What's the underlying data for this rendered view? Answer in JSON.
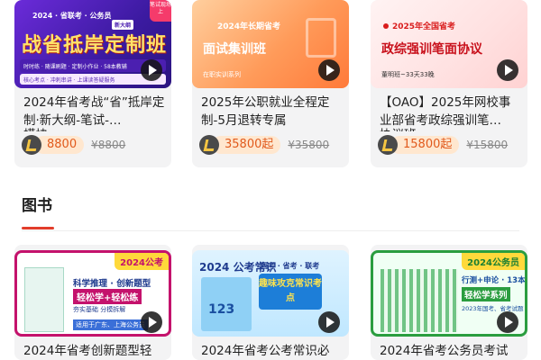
{
  "courses": [
    {
      "thumb": {
        "year_tag": "2024 · 省联考 · 公务员",
        "headline": "战省抵岸定制班",
        "badge": "新大纲",
        "corner": "笔试现场上",
        "features": "时时练 · 随课刷题 · 定制小作业 · 58本教辅",
        "features2": "核心考点 · 冲刺串讲 · 上课读答疑服务"
      },
      "title": "2024年省考战“省”抵岸定制·新大纲-笔试-…",
      "title_frag": "模块",
      "price": "8800",
      "old_price": "¥8800"
    },
    {
      "thumb": {
        "year_tag": "2024年长期省考",
        "headline": "面试集训班",
        "sub": "在职实训系列"
      },
      "title": "2025年公职就业全程定制-5月退转专属",
      "title_frag": "",
      "price": "35800起",
      "old_price": "¥35800"
    },
    {
      "thumb": {
        "year_tag": "2025年全国省考",
        "headline": "政综强训笔面协议",
        "sub": "董明班~33天33晚"
      },
      "title": "【OAO】2025年网校事业部省考政综强训笔…",
      "title_frag": "协议班",
      "price": "15800起",
      "old_price": "¥15800"
    }
  ],
  "section": {
    "title": "图书"
  },
  "books": [
    {
      "ribbon": "2024公考",
      "cover_line1": "科学推理 · 创新题型",
      "cover_line2": "轻松学+轻松练",
      "cover_line3": "夯实基础 分模拆解",
      "cover_line4": "适用于广东、上海公务员",
      "title": "2024年省考创新题型轻"
    },
    {
      "ribbon": "2024 公考常识",
      "cover_line1": "国考 · 省考 · 联考",
      "cover_line2": "趣味攻克常识考点",
      "cover_line3": "123",
      "title": "2024年省考公考常识必"
    },
    {
      "ribbon": "2024公务员",
      "cover_line1": "行测+申论 · 13本套",
      "cover_line2": "轻松学系列",
      "cover_line3": "2023年国考、省考试题",
      "title": "2024年省考公务员考试"
    }
  ]
}
